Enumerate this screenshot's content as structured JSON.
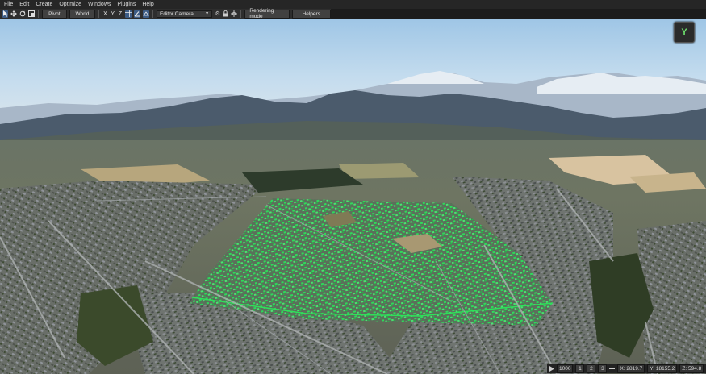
{
  "menu": [
    "File",
    "Edit",
    "Create",
    "Optimize",
    "Windows",
    "Plugins",
    "Help"
  ],
  "toolbar": {
    "pivot_label": "Pivot",
    "world_label": "World",
    "axes": [
      "X",
      "Y",
      "Z"
    ],
    "camera_value": "Editor Camera",
    "rendering_label": "Rendering mode",
    "helpers_label": "Helpers"
  },
  "gizmo": {
    "axis_label": "Y",
    "color": "#6fe36f"
  },
  "status": {
    "speed": "1000",
    "modes": [
      "1",
      "2",
      "3"
    ],
    "x": "X: 2819.7",
    "y": "Y: 18155.2",
    "z": "Z: 594.8"
  },
  "colors": {
    "selection": "#2fe05a",
    "sky": "#a9cbe6"
  }
}
